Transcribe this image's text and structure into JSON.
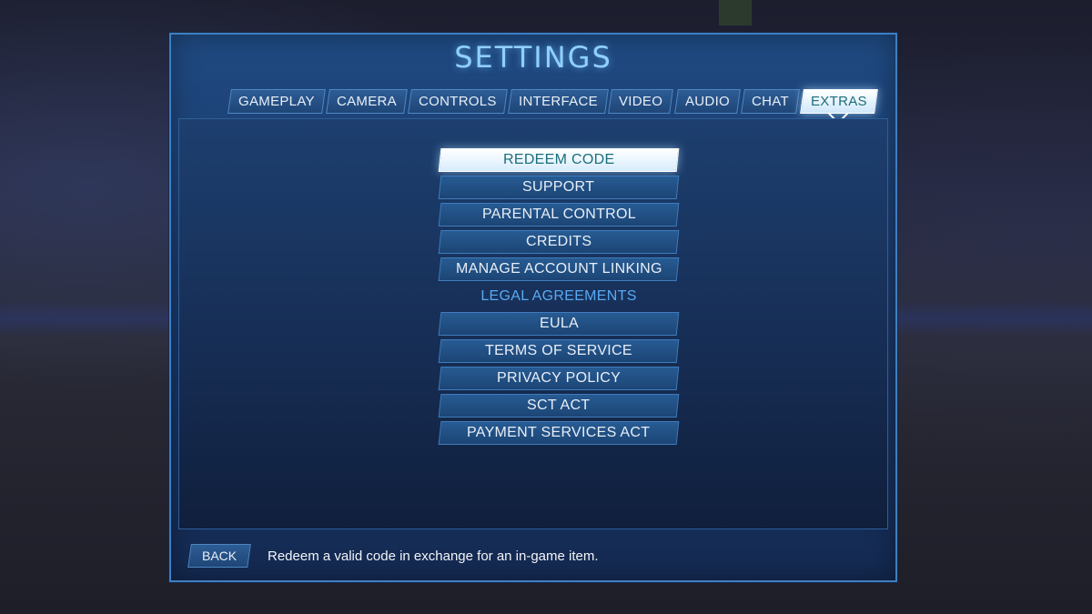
{
  "title": "SETTINGS",
  "tabs": [
    {
      "label": "GAMEPLAY",
      "active": false
    },
    {
      "label": "CAMERA",
      "active": false
    },
    {
      "label": "CONTROLS",
      "active": false
    },
    {
      "label": "INTERFACE",
      "active": false
    },
    {
      "label": "VIDEO",
      "active": false
    },
    {
      "label": "AUDIO",
      "active": false
    },
    {
      "label": "CHAT",
      "active": false
    },
    {
      "label": "EXTRAS",
      "active": true
    }
  ],
  "menu": {
    "items": [
      {
        "label": "REDEEM CODE",
        "selected": true
      },
      {
        "label": "SUPPORT"
      },
      {
        "label": "PARENTAL CONTROL"
      },
      {
        "label": "CREDITS"
      },
      {
        "label": "MANAGE ACCOUNT LINKING"
      }
    ],
    "section_header": "LEGAL AGREEMENTS",
    "legal_items": [
      {
        "label": "EULA"
      },
      {
        "label": "TERMS OF SERVICE"
      },
      {
        "label": "PRIVACY POLICY"
      },
      {
        "label": "SCT ACT"
      },
      {
        "label": "PAYMENT SERVICES ACT"
      }
    ]
  },
  "footer": {
    "back_label": "BACK",
    "hint": "Redeem a valid code in exchange for an in-game item."
  },
  "colors": {
    "accent": "#8fd0ff",
    "section_header": "#59a9f2",
    "selected_text": "#1b6f7a"
  }
}
